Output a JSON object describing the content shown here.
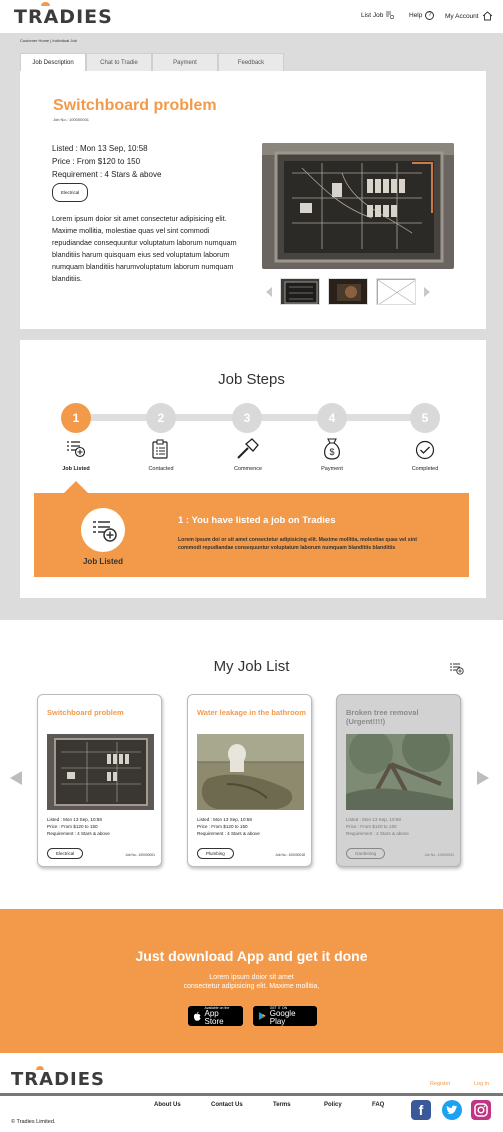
{
  "header": {
    "logo": "TRADIES",
    "list_job": "List Job",
    "help": "Help",
    "my_account": "My Account"
  },
  "breadcrumb": "Customer Home | Individual Job",
  "tabs": [
    {
      "label": "Job Description",
      "active": true
    },
    {
      "label": "Chat to Tradie",
      "active": false
    },
    {
      "label": "Payment",
      "active": false
    },
    {
      "label": "Feedback",
      "active": false
    }
  ],
  "job": {
    "title": "Switchboard problem",
    "job_no": "Job No.: 100000001",
    "listed": "Listed : Mon 13 Sep, 10:58",
    "price": "Price : From $120 to 150",
    "requirement": "Requirement : 4 Stars & above",
    "tag": "Electrical",
    "description": "Lorem ipsum doior sit amet consectetur adipisicing elit. Maxime mollitia, molestiae quas vel sint commodi repudiandae consequuntur voluptatum laborum numquam blanditiis harum quisquam eius sed voluptatum laborum numquam blanditiis harumvoluptatum laborum numquam blanditiis."
  },
  "job_steps": {
    "title": "Job Steps",
    "current_step": 1,
    "steps": [
      {
        "num": "1",
        "label": "Job Listed",
        "icon": "list-add-icon"
      },
      {
        "num": "2",
        "label": "Contacted",
        "icon": "clipboard-icon"
      },
      {
        "num": "3",
        "label": "Commence",
        "icon": "hammer-icon"
      },
      {
        "num": "4",
        "label": "Payment",
        "icon": "money-bag-icon"
      },
      {
        "num": "5",
        "label": "Completed",
        "icon": "check-circle-icon"
      }
    ],
    "detail_label": "Job Listed",
    "detail_title": "1 : You have listed a job on Tradies",
    "detail_text": "Lorem ipsum doi or sit amet consectetur adipisicing elit. Maxime mollitia, molestiae quas vel sint commodi repudiandae consequuntur voluptatum laborum numquam blanditiis blanditiis"
  },
  "job_list": {
    "title": "My Job List",
    "cards": [
      {
        "title": "Switchboard problem",
        "listed": "Listed : Mon 13 Sep, 10:58",
        "price": "Price : From $120 to 150",
        "requirement": "Requirement : 4 Stars & above",
        "tag": "Electrical",
        "job_no": "Job No.: 100000001",
        "dim": false
      },
      {
        "title": "Water leakage in the bathroom",
        "listed": "Listed : Mon 13 Sep, 10:58",
        "price": "Price : From $120 to 150",
        "requirement": "Requirement : 4 Stars & above",
        "tag": "Plumbing",
        "job_no": "Job No.: 100000018",
        "dim": false
      },
      {
        "title": "Broken tree removal (Urgent!!!!)",
        "listed": "Listed : Mon 13 Sep, 10:58",
        "price": "Price : From $120 to 150",
        "requirement": "Requirement : 4 Stars & above",
        "tag": "Gardening",
        "job_no": "Job No.: 100000011",
        "dim": true
      }
    ]
  },
  "banner": {
    "title": "Just download App and get it done",
    "line1": "Lorem ipsum doior sit amet",
    "line2": "consectetur adipisicing  elit. Maxime mollitia,",
    "appstore_small": "Available on the",
    "appstore_big": "App Store",
    "googleplay_small": "GET IT ON",
    "googleplay_big": "Google Play"
  },
  "footer": {
    "logo": "TRADIES",
    "register": "Register",
    "login": "Log in",
    "links": [
      "About Us",
      "Contact Us",
      "Terms",
      "Policy",
      "FAQ"
    ],
    "copyright": "© Tradies Limited."
  },
  "colors": {
    "accent": "#f39a4a",
    "gray_bg": "#dcdcdc",
    "facebook": "#3b5998",
    "twitter": "#1da1f2",
    "instagram": "#c13584"
  }
}
